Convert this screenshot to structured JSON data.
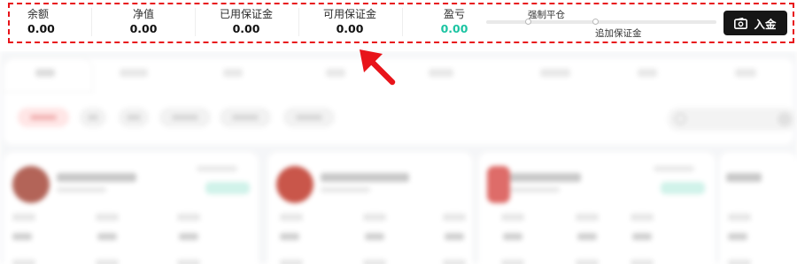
{
  "metrics": {
    "balance": {
      "label": "余额",
      "value": "0.00"
    },
    "equity": {
      "label": "净值",
      "value": "0.00"
    },
    "used_margin": {
      "label": "已用保证金",
      "value": "0.00"
    },
    "available_margin": {
      "label": "可用保证金",
      "value": "0.00"
    },
    "pnl": {
      "label": "盈亏",
      "value": "0.00"
    }
  },
  "risk_meter": {
    "stop_out_label": "强制平仓",
    "margin_call_label": "追加保证金"
  },
  "deposit_button": {
    "label": "入金",
    "icon": "wallet-icon"
  },
  "colors": {
    "highlight_dash": "#e8141a",
    "arrow": "#e8141a",
    "pnl_value": "#1cc4a2",
    "deposit_bg": "#161616"
  }
}
